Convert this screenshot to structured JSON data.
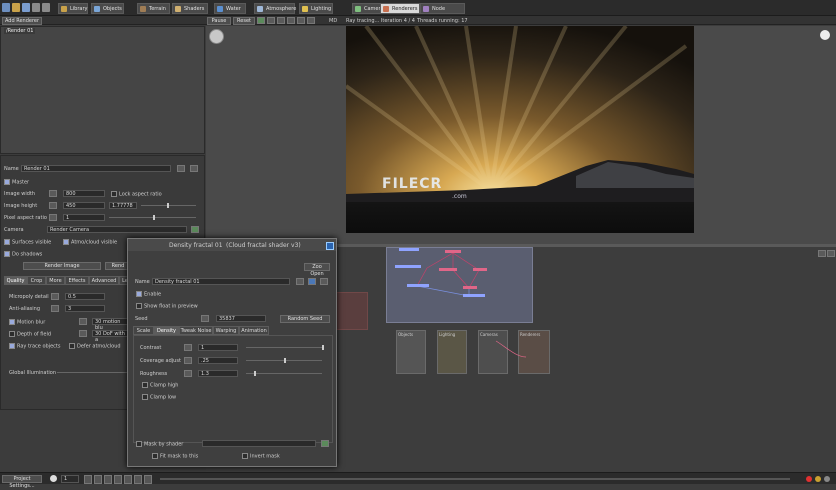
{
  "toolbar": {
    "tabs": [
      {
        "label": "Library",
        "icon": "library-icon",
        "color": "#c9a24a"
      },
      {
        "label": "Objects",
        "icon": "objects-icon",
        "color": "#7aa6d8"
      },
      {
        "label": "Terrain",
        "icon": "terrain-icon",
        "color": "#a07d55"
      },
      {
        "label": "Shaders",
        "icon": "shaders-icon",
        "color": "#d0b070"
      },
      {
        "label": "Water",
        "icon": "water-icon",
        "color": "#5a8fd0"
      },
      {
        "label": "Atmosphere",
        "icon": "atmosphere-icon",
        "color": "#9fb8d8"
      },
      {
        "label": "Lighting",
        "icon": "lighting-icon",
        "color": "#e0c050"
      },
      {
        "label": "Cameras",
        "icon": "cameras-icon",
        "color": "#7fbf7f"
      },
      {
        "label": "Renderers",
        "icon": "renderers-icon",
        "color": "#c87050",
        "active": true
      },
      {
        "label": "Node Network",
        "icon": "node-network-icon",
        "color": "#a080c0"
      }
    ],
    "add_renderer": "Add Renderer",
    "pause": "Pause",
    "reset": "Reset",
    "quality": "MD",
    "status": "Ray tracing... Iteration 4 / 4",
    "threads": "Threads running: 17"
  },
  "renderer_list": {
    "items": [
      "/Render 01"
    ]
  },
  "render_props": {
    "name_label": "Name",
    "name_value": "Render 01",
    "master_label": "Master",
    "image_width_label": "Image width",
    "image_width_value": "800",
    "lock_aspect_label": "Lock aspect ratio",
    "image_height_label": "Image height",
    "image_height_value": "450",
    "aspect_value": "1.77778",
    "pixel_aspect_label": "Pixel aspect ratio",
    "pixel_aspect_value": "1",
    "camera_label": "Camera",
    "camera_value": "Render Camera",
    "surfaces_visible": "Surfaces visible",
    "atmo_visible": "Atmo/cloud visible",
    "do_shadows": "Do shadows",
    "render_image": "Render Image",
    "render_button_2": "Rend",
    "tabs": [
      "Quality",
      "Crop",
      "More",
      "Effects",
      "Advanced",
      "Le"
    ],
    "micropoly_label": "Micropoly detail",
    "micropoly_value": "0.5",
    "anti_alias_label": "Anti-aliasing",
    "anti_alias_value": "3",
    "motion_blur": "Motion blur",
    "motion_blur_field": "30 motion blu",
    "depth_of_field": "Depth of field",
    "dof_field": "30 DoF with a",
    "ray_trace": "Ray trace objects",
    "defer_atmo": "Defer atmo/cloud",
    "global_illum": "Global Illumination"
  },
  "dialog": {
    "title": "Density fractal 01",
    "subtitle": "(Cloud fractal shader v3)",
    "zoo_open": "Zoo Open",
    "name_label": "Name",
    "name_value": "Density fractal 01",
    "enable": "Enable",
    "show_preview": "Show float in preview",
    "seed_label": "Seed",
    "seed_value": "35837",
    "random_seed": "Random Seed",
    "tabs": [
      "Scale",
      "Density",
      "Tweak Noise",
      "Warping",
      "Animation"
    ],
    "contrast_label": "Contrast",
    "contrast_value": "1",
    "contrast_level": 1.0,
    "coverage_label": "Coverage adjust",
    "coverage_value": ".25",
    "coverage_level": 0.5,
    "roughness_label": "Roughness",
    "roughness_value": "1.3",
    "roughness_level": 0.1,
    "clamp_high": "Clamp high",
    "clamp_low": "Clamp low",
    "mask_by_shader": "Mask by shader",
    "fit_mask": "Fit mask to this",
    "invert_mask": "Invert mask"
  },
  "node_network": {
    "groups": [
      "Objects",
      "Lighting",
      "Cameras",
      "Renderers"
    ],
    "watermark": "FILECR",
    "watermark_sub": ".com"
  },
  "statusbar": {
    "project_settings": "Project Settings...",
    "frame_value": "1"
  }
}
